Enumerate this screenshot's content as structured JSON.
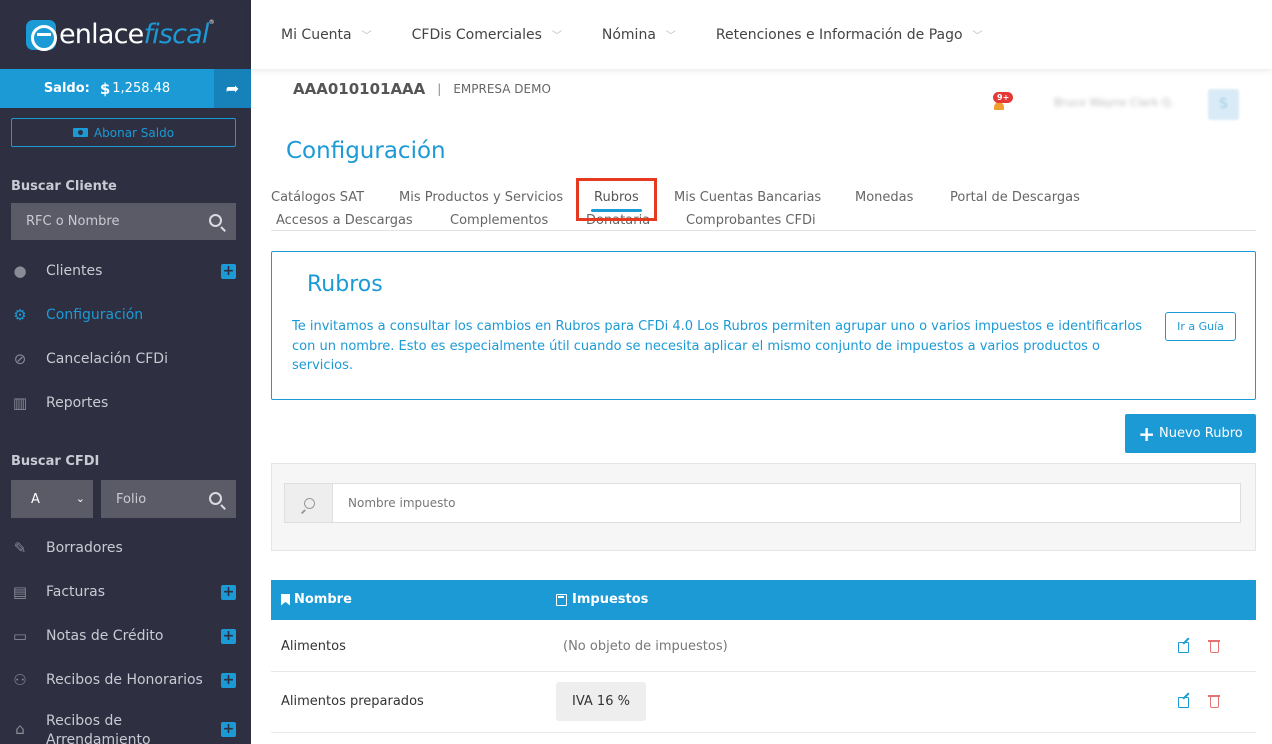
{
  "brand": {
    "name_a": "enlace",
    "name_b": "fiscal",
    "reg": "®"
  },
  "saldo": {
    "label": "Saldo:",
    "currency": "$",
    "amount": "1,258.48"
  },
  "sidebar": {
    "abonar_label": "Abonar Saldo",
    "buscar_cliente_title": "Buscar Cliente",
    "buscar_cliente_placeholder": "RFC o Nombre",
    "items_top": [
      {
        "label": "Clientes",
        "icon": "user-icon",
        "plus": true
      },
      {
        "label": "Configuración",
        "icon": "gear-icon",
        "active": true
      },
      {
        "label": "Cancelación CFDi",
        "icon": "ban-icon"
      },
      {
        "label": "Reportes",
        "icon": "bar-chart-icon"
      }
    ],
    "buscar_cfdi_title": "Buscar CFDI",
    "serie_value": "A",
    "folio_placeholder": "Folio",
    "items_bottom": [
      {
        "label": "Borradores",
        "icon": "edit-doc-icon"
      },
      {
        "label": "Facturas",
        "icon": "document-icon",
        "plus": true
      },
      {
        "label": "Notas de Crédito",
        "icon": "credit-card-icon",
        "plus": true
      },
      {
        "label": "Recibos de Honorarios",
        "icon": "users-icon",
        "plus": true
      },
      {
        "label": "Recibos de Arrendamiento",
        "icon": "home-icon",
        "plus": true
      }
    ]
  },
  "topnav": {
    "menus": [
      "Mi Cuenta",
      "CFDis Comerciales",
      "Nómina",
      "Retenciones e Información de Pago"
    ]
  },
  "company": {
    "rfc": "AAA010101AAA",
    "separator": "|",
    "name": "EMPRESA DEMO"
  },
  "notifications": {
    "badge": "9+"
  },
  "user": {
    "name": "Bruce Wayne Clark Q.",
    "initial": "S"
  },
  "page_title": "Configuración",
  "tabs": [
    "Catálogos SAT",
    "Mis Productos y Servicios",
    "Rubros",
    "Mis Cuentas Bancarias",
    "Monedas",
    "Portal de Descargas",
    "Accesos a Descargas",
    "Complementos",
    "Donataria",
    "Comprobantes CFDi"
  ],
  "active_tab": "Rubros",
  "info": {
    "title": "Rubros",
    "text": "Te invitamos a consultar los cambios en Rubros para CFDi 4.0 Los Rubros permiten agrupar uno o varios impuestos e identificarlos con un nombre. Esto es especialmente útil cuando se necesita aplicar el mismo conjunto de impuestos a varios productos o servicios.",
    "guide_button": "Ir a Guía"
  },
  "new_button": {
    "plus": "+",
    "label": "Nuevo Rubro"
  },
  "search": {
    "placeholder": "Nombre impuesto"
  },
  "table": {
    "headers": {
      "name": "Nombre",
      "taxes": "Impuestos"
    },
    "rows": [
      {
        "name": "Alimentos",
        "taxes": "(No objeto de impuestos)"
      },
      {
        "name": "Alimentos preparados",
        "taxes": "IVA 16 %"
      }
    ]
  },
  "colors": {
    "accent": "#1c9ad6",
    "sidebar_bg": "#2e2f40",
    "highlight": "#e53a1f",
    "danger": "#e57373"
  }
}
